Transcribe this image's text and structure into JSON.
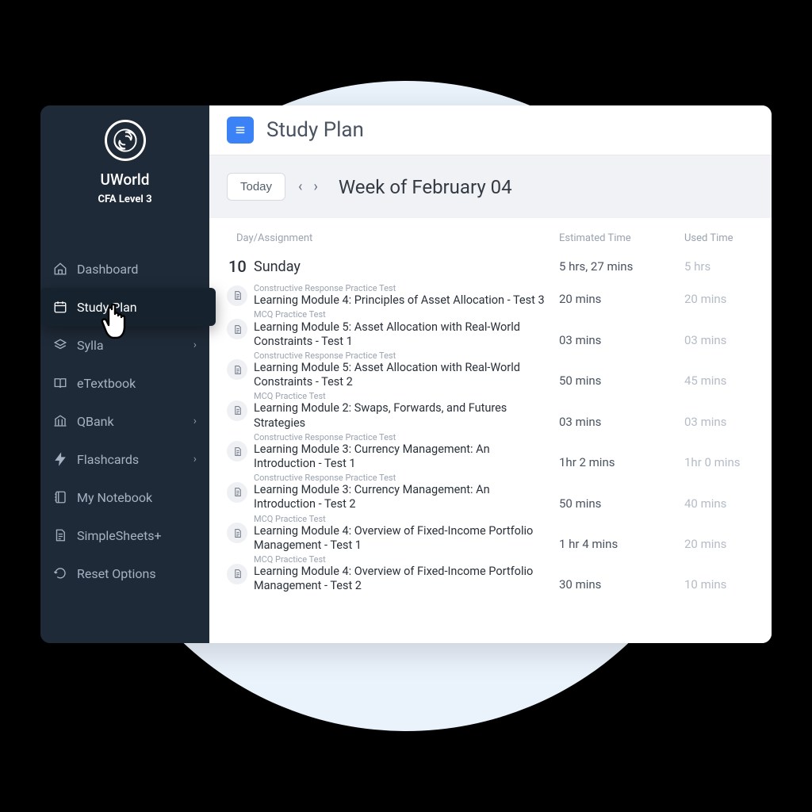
{
  "brand": {
    "name": "UWorld",
    "subtitle": "CFA Level 3"
  },
  "sidebar": {
    "items": [
      {
        "label": "Dashboard",
        "icon": "home-icon",
        "chevron": false
      },
      {
        "label": "Study Plan",
        "icon": "calendar-icon",
        "chevron": false,
        "active": true
      },
      {
        "label": "Sylla",
        "icon": "stack-icon",
        "chevron": true
      },
      {
        "label": "eTextbook",
        "icon": "book-icon",
        "chevron": false
      },
      {
        "label": "QBank",
        "icon": "bank-icon",
        "chevron": true
      },
      {
        "label": "Flashcards",
        "icon": "bolt-icon",
        "chevron": true
      },
      {
        "label": "My Notebook",
        "icon": "notebook-icon",
        "chevron": false
      },
      {
        "label": "SimpleSheets+",
        "icon": "sheet-icon",
        "chevron": false
      },
      {
        "label": "Reset Options",
        "icon": "reset-icon",
        "chevron": false
      }
    ]
  },
  "header": {
    "title": "Study Plan"
  },
  "weekbar": {
    "today": "Today",
    "label": "Week of February 04"
  },
  "table": {
    "headers": {
      "day": "Day/Assignment",
      "est": "Estimated Time",
      "used": "Used Time"
    },
    "day": {
      "num": "10",
      "name": "Sunday",
      "est": "5 hrs, 27 mins",
      "used": "5 hrs"
    },
    "assignments": [
      {
        "type": "Constructive Response Practice Test",
        "title": "Learning Module 4: Principles of Asset Allocation - Test 3",
        "est": "20 mins",
        "used": "20 mins"
      },
      {
        "type": "MCQ Practice Test",
        "title": "Learning Module 5: Asset Allocation with Real-World Constraints - Test 1",
        "est": "03 mins",
        "used": "03 mins"
      },
      {
        "type": "Constructive Response Practice Test",
        "title": "Learning Module 5: Asset Allocation with Real-World Constraints - Test 2",
        "est": "50 mins",
        "used": "45 mins"
      },
      {
        "type": "MCQ Practice Test",
        "title": "Learning Module 2: Swaps, Forwards, and Futures Strategies",
        "est": "03 mins",
        "used": "03 mins"
      },
      {
        "type": "Constructive Response Practice Test",
        "title": "Learning Module 3: Currency Management: An Introduction - Test 1",
        "est": "1hr 2 mins",
        "used": "1hr 0 mins"
      },
      {
        "type": "Constructive Response Practice Test",
        "title": "Learning Module 3: Currency Management: An Introduction - Test 2",
        "est": "50 mins",
        "used": "40 mins"
      },
      {
        "type": "MCQ Practice Test",
        "title": "Learning Module 4: Overview of Fixed-Income Portfolio Management - Test 1",
        "est": "1 hr 4 mins",
        "used": "20 mins"
      },
      {
        "type": "MCQ Practice Test",
        "title": "Learning Module 4: Overview of Fixed-Income Portfolio Management - Test 2",
        "est": "30 mins",
        "used": "10 mins"
      }
    ]
  }
}
